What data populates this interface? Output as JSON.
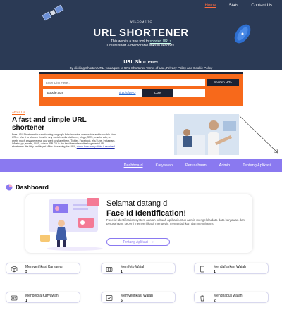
{
  "nav": {
    "items": [
      "Home",
      "Stats",
      "Contact Us"
    ],
    "active": "Home"
  },
  "hero": {
    "welcome": "WELCOME TO",
    "title": "URL SHORTENER",
    "sub1_prefix": "This web  is a free tool to ",
    "sub1_link": "shorten URLs",
    "sub2": "Create short & memorable links in seconds."
  },
  "shortener": {
    "title": "URL Shortener",
    "terms_prefix": "By clicking Shorten URL, you agree to URL Shortener ",
    "terms_link": "Terms of Use",
    "terms_sep": ", ",
    "privacy_link": "Privacy Policy",
    "and": " and ",
    "cookie_link": "Cookie Policy",
    "input_placeholder": "Enter Link Here...",
    "shorten_label": "Shorten URL",
    "result_original": "google.com",
    "result_short": "tf.pp/ufDNU",
    "copy_label": "Copy"
  },
  "about": {
    "tag": "About Us",
    "heading": "A fast and simple URL shortener",
    "body": "Free URL Shortener for transforming long ugly links into nice, memorable and trackable short URLs. Use it to shorten links for any social media platforms, blogs, SMS, emails, ads, or pretty much anywhere else you want to share them. Twitter, Facebook, YouTube, Instagram, WhatsApp, emails, SMS, videos. RB.GY is the best free alternative to generic URL shorteners like bitly and tinyurl. After shortening the URL, ",
    "link": "check how many clicks it received"
  },
  "dash_nav": {
    "items": [
      "Dashboard",
      "Karyawan",
      "Perusahaan",
      "Admin",
      "Tentang Aplikasi"
    ],
    "active": "Dashboard"
  },
  "dashboard": {
    "title": "Dashboard",
    "welcome_line1": "Selamat datang di",
    "welcome_line2": "Face Id Identification!",
    "welcome_body": "Face id identification system adalah sebuah aplikasi untuk admin mengelola data-data karyawan dan perusahaan, seperti memverifikasi, mengedit, menambahkan dan menghapus.",
    "about_button": "Tentang Aplikasi",
    "stats": [
      {
        "label": "Memverifikasi Karyawan",
        "value": "3",
        "icon": "cube-icon"
      },
      {
        "label": "Memfoto Wajah",
        "value": "1",
        "icon": "camera-icon"
      },
      {
        "label": "Mendaftarkan Wajah",
        "value": "1",
        "icon": "phone-icon"
      },
      {
        "label": "Mengelola Karyawan",
        "value": "1",
        "icon": "badge-icon"
      },
      {
        "label": "Memverifikasi Wajah",
        "value": "5",
        "icon": "check-frame-icon"
      },
      {
        "label": "Menghapus wajah",
        "value": "2",
        "icon": "trash-icon"
      }
    ]
  }
}
